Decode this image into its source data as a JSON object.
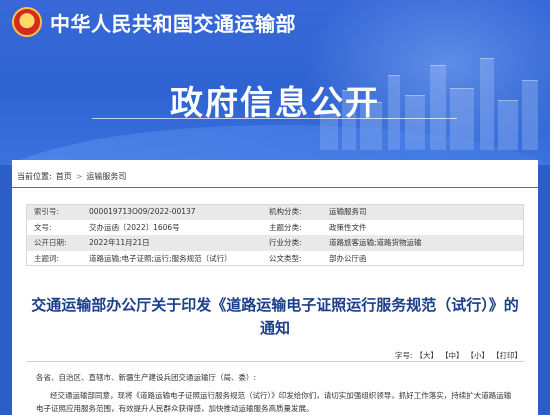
{
  "header": {
    "site_title": "中华人民共和国交通运输部",
    "hero_title": "政府信息公开",
    "emblem_glyph": "★"
  },
  "breadcrumb": {
    "prefix": "当前位置:",
    "items": [
      "首页",
      "运输服务司"
    ],
    "separator": ">"
  },
  "meta": {
    "rows": [
      {
        "label1": "索引号:",
        "value1": "000019713O09/2022-00137",
        "label2": "机构分类:",
        "value2": "运输服务司"
      },
      {
        "label1": "文号:",
        "value1": "交办运函〔2022〕1606号",
        "label2": "主题分类:",
        "value2": "政策性文件"
      },
      {
        "label1": "公开日期:",
        "value1": "2022年11月21日",
        "label2": "行业分类:",
        "value2": "道路旅客运输;道路货物运输"
      },
      {
        "label1": "主题词:",
        "value1": "道路运输;电子证照;运行;服务规范（试行）",
        "label2": "公文类型:",
        "value2": "部办公厅函"
      }
    ]
  },
  "document": {
    "title_line1": "交通运输部办公厅关于印发《道路运输电子证照运行服务规范（试行）》的",
    "title_line2": "通知"
  },
  "fontsize": {
    "label": "字号:",
    "large": "【大】",
    "medium": "【中】",
    "small": "【小】",
    "print": "【打印】"
  },
  "body": {
    "salutation": "各省、自治区、直辖市、新疆生产建设兵团交通运输厅（局、委）:",
    "line1": "经交通运输部同意，现将《道路运输电子证照运行服务规范（试行）》印发给你们，请切实加强组织领导，抓好工作落实，持续扩大道路运输",
    "line2": "电子证照应用服务范围，有效提升人民群众获得感，加快推动运输服务高质量发展。"
  },
  "colors": {
    "banner_blue": "#2f63d2",
    "title_blue": "#1a3e8a",
    "accent_line": "#3b6fd6"
  }
}
